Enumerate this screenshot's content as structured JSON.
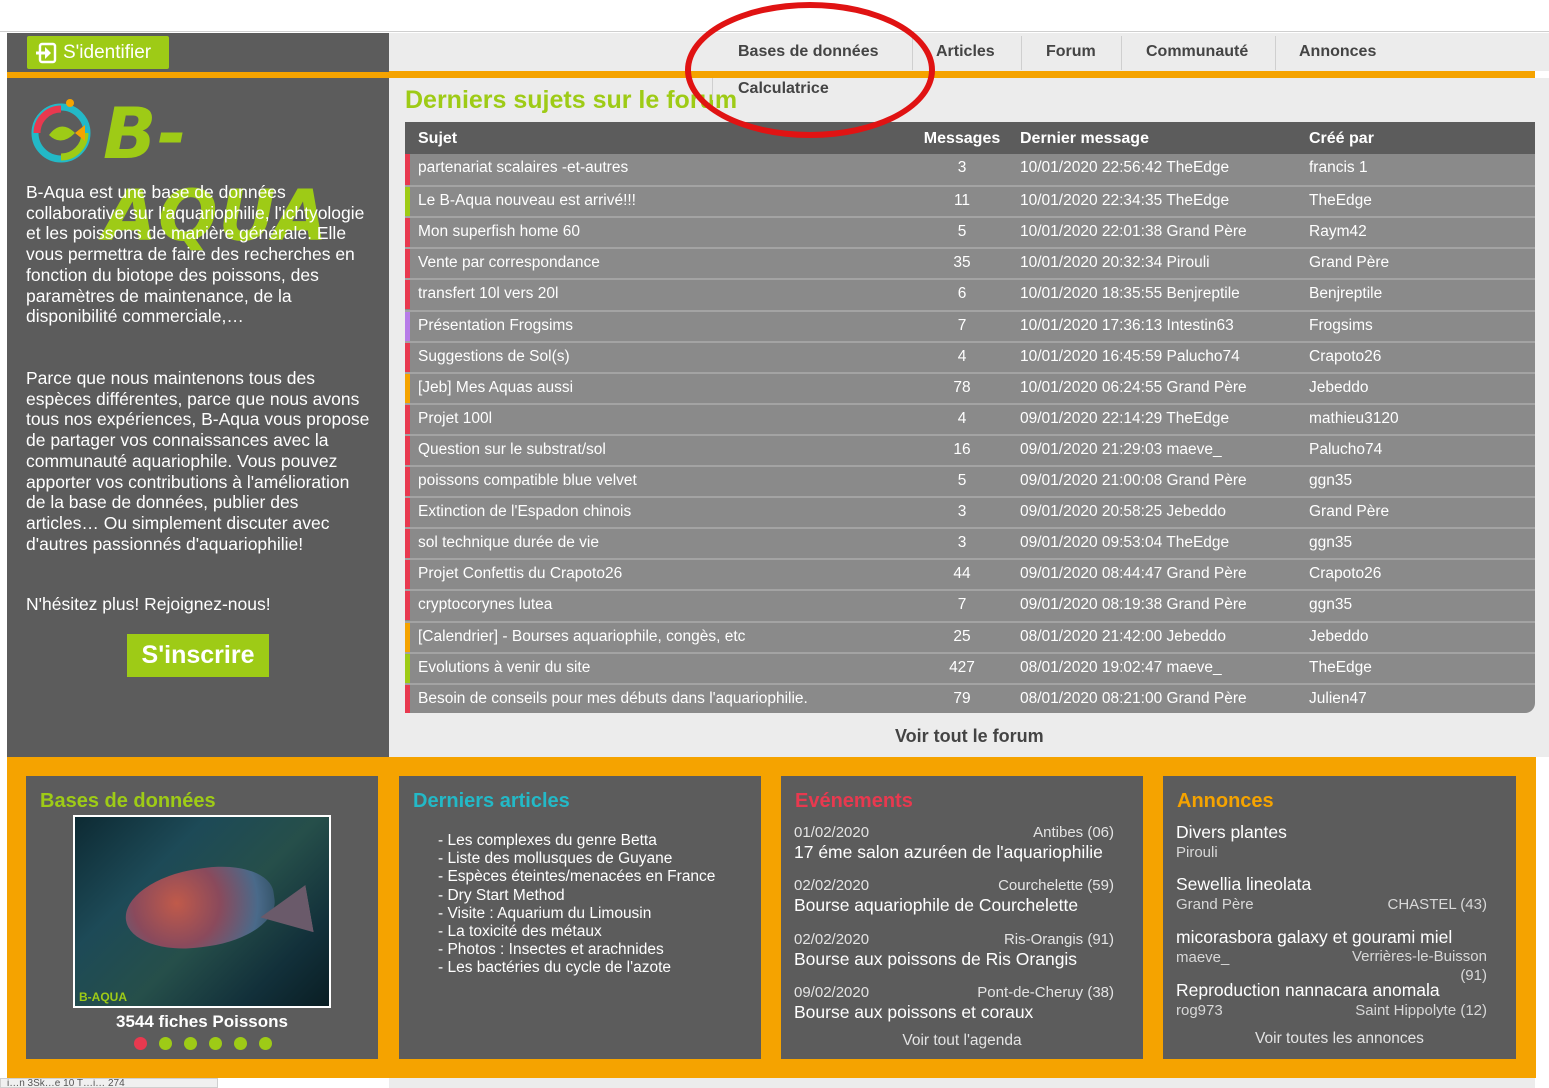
{
  "login": {
    "label": "S'identifier"
  },
  "brand": {
    "logo_text": "B-AQUA"
  },
  "sidebar": {
    "paragraph1": "B-Aqua est une base de données collaborative sur l'aquariophilie, l'ichtyologie et les poissons de manière générale. Elle vous permettra de faire des recherches en fonction du biotope des poissons, des paramètres de maintenance, de la disponibilité commerciale,…",
    "paragraph2": "Parce que nous maintenons tous des espèces différentes, parce que nous avons tous nos expériences, B-Aqua vous propose de partager vos connaissances avec la communauté aquariophile. Vous pouvez apporter vos contributions à l'amélioration de la base de données, publier des articles… Ou simplement discuter avec d'autres passionnés d'aquariophilie!",
    "paragraph3": "N'hésitez plus! Rejoignez-nous!",
    "signup_label": "S'inscrire"
  },
  "nav": {
    "items": [
      "Bases de données",
      "Articles",
      "Forum",
      "Communauté",
      "Annonces"
    ],
    "submenu": "Calculatrice"
  },
  "forum": {
    "title": "Derniers sujets sur le forum",
    "headers": [
      "Sujet",
      "Messages",
      "Dernier message",
      "Créé par"
    ],
    "rows": [
      {
        "subject": "partenariat scalaires -et-autres",
        "messages": "3",
        "last": "10/01/2020 22:56:42 TheEdge",
        "author": "francis 1",
        "color": "#e8394f"
      },
      {
        "subject": "Le B-Aqua nouveau est arrivé!!!",
        "messages": "11",
        "last": "10/01/2020 22:34:35 TheEdge",
        "author": "TheEdge",
        "color": "#9ecb16"
      },
      {
        "subject": "Mon superfish home 60",
        "messages": "5",
        "last": "10/01/2020 22:01:38 Grand Père",
        "author": "Raym42",
        "color": "#e8394f"
      },
      {
        "subject": "Vente par correspondance",
        "messages": "35",
        "last": "10/01/2020 20:32:34 Pirouli",
        "author": "Grand Père",
        "color": "#e8394f"
      },
      {
        "subject": "transfert 10l vers 20l",
        "messages": "6",
        "last": "10/01/2020 18:35:55 Benjreptile",
        "author": "Benjreptile",
        "color": "#e8394f"
      },
      {
        "subject": "Présentation Frogsims",
        "messages": "7",
        "last": "10/01/2020 17:36:13 Intestin63",
        "author": "Frogsims",
        "color": "#b77ce8"
      },
      {
        "subject": "Suggestions de Sol(s)",
        "messages": "4",
        "last": "10/01/2020 16:45:59 Palucho74",
        "author": "Crapoto26",
        "color": "#e8394f"
      },
      {
        "subject": "[Jeb] Mes Aquas aussi",
        "messages": "78",
        "last": "10/01/2020 06:24:55 Grand Père",
        "author": "Jebeddo",
        "color": "#f5a300"
      },
      {
        "subject": "Projet 100l",
        "messages": "4",
        "last": "09/01/2020 22:14:29 TheEdge",
        "author": "mathieu3120",
        "color": "#e8394f"
      },
      {
        "subject": "Question sur le substrat/sol",
        "messages": "16",
        "last": "09/01/2020 21:29:03 maeve_",
        "author": "Palucho74",
        "color": "#e8394f"
      },
      {
        "subject": "poissons compatible blue velvet",
        "messages": "5",
        "last": "09/01/2020 21:00:08 Grand Père",
        "author": "ggn35",
        "color": "#e8394f"
      },
      {
        "subject": "Extinction de l'Espadon chinois",
        "messages": "3",
        "last": "09/01/2020 20:58:25 Jebeddo",
        "author": "Grand Père",
        "color": "#e8394f"
      },
      {
        "subject": "sol technique durée de vie",
        "messages": "3",
        "last": "09/01/2020 09:53:04 TheEdge",
        "author": "ggn35",
        "color": "#e8394f"
      },
      {
        "subject": "Projet Confettis du Crapoto26",
        "messages": "44",
        "last": "09/01/2020 08:44:47 Grand Père",
        "author": "Crapoto26",
        "color": "#e8394f"
      },
      {
        "subject": "cryptocorynes lutea",
        "messages": "7",
        "last": "09/01/2020 08:19:38 Grand Père",
        "author": "ggn35",
        "color": "#e8394f"
      },
      {
        "subject": "[Calendrier] - Bourses aquariophile, congès, etc",
        "messages": "25",
        "last": "08/01/2020 21:42:00 Jebeddo",
        "author": "Jebeddo",
        "color": "#f5a300"
      },
      {
        "subject": "Evolutions à venir du site",
        "messages": "427",
        "last": "08/01/2020 19:02:47 maeve_",
        "author": "TheEdge",
        "color": "#9ecb16"
      },
      {
        "subject": "Besoin de conseils pour mes débuts dans l'aquariophilie.",
        "messages": "79",
        "last": "08/01/2020 08:21:00 Grand Père",
        "author": "Julien47",
        "color": "#e8394f"
      }
    ],
    "see_all": "Voir tout le forum"
  },
  "databases": {
    "title": "Bases de données",
    "image_logo": "B-AQUA",
    "count_text": "3544 fiches Poissons",
    "dots": 6,
    "active_dot": 0
  },
  "articles": {
    "title": "Derniers articles",
    "items": [
      "- Les complexes du genre Betta",
      "- Liste des mollusques de Guyane",
      "- Espèces éteintes/menacées en France",
      "- Dry Start Method",
      "- Visite : Aquarium du Limousin",
      "- La toxicité des métaux",
      "- Photos : Insectes et arachnides",
      "- Les bactéries du cycle de l'azote"
    ]
  },
  "events": {
    "title": "Evénements",
    "items": [
      {
        "date": "01/02/2020",
        "place": "Antibes (06)",
        "name": "17 éme salon azuréen de l'aquariophilie"
      },
      {
        "date": "02/02/2020",
        "place": "Courchelette (59)",
        "name": "Bourse aquariophile de Courchelette"
      },
      {
        "date": "02/02/2020",
        "place": "Ris-Orangis (91)",
        "name": "Bourse aux poissons de Ris Orangis"
      },
      {
        "date": "09/02/2020",
        "place": "Pont-de-Cheruy (38)",
        "name": "Bourse aux poissons et coraux"
      }
    ],
    "see_all": "Voir tout l'agenda"
  },
  "ads": {
    "title": "Annonces",
    "items": [
      {
        "name": "Divers plantes",
        "user": "Pirouli",
        "location": ""
      },
      {
        "name": "Sewellia lineolata",
        "user": "Grand Père",
        "location": "CHASTEL (43)"
      },
      {
        "name": "micorasbora galaxy et gourami miel",
        "user": "maeve_",
        "location": "Verrières-le-Buisson (91)"
      },
      {
        "name": "Reproduction nannacara anomala",
        "user": "rog973",
        "location": "Saint Hippolyte (12)"
      }
    ],
    "see_all": "Voir toutes les annonces"
  },
  "status_bar": {
    "text": "i…n 3Sk…e 10 T…i… 274"
  },
  "colors": {
    "green": "#9ecb16",
    "orange": "#f5a300",
    "dark": "#5c5c5c",
    "red": "#e8394f",
    "teal": "#23b9c7",
    "annotation": "#e01313"
  }
}
